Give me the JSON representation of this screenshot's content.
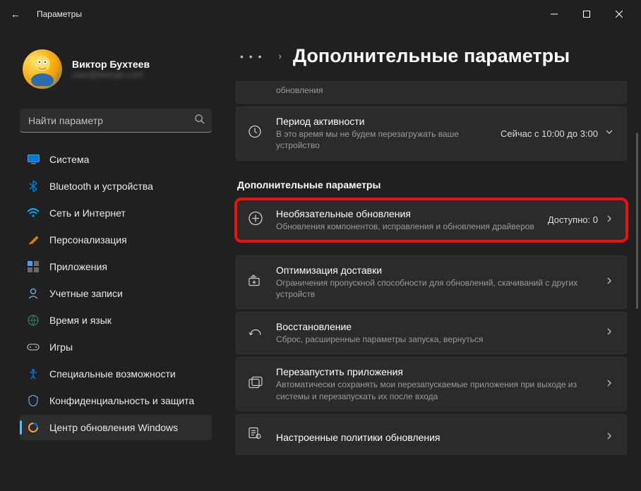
{
  "titlebar": {
    "back": "←",
    "title": "Параметры"
  },
  "profile": {
    "name": "Виктор Бухтеев",
    "email": "user@domain.com"
  },
  "search": {
    "placeholder": "Найти параметр"
  },
  "nav": [
    {
      "label": "Система"
    },
    {
      "label": "Bluetooth и устройства"
    },
    {
      "label": "Сеть и Интернет"
    },
    {
      "label": "Персонализация"
    },
    {
      "label": "Приложения"
    },
    {
      "label": "Учетные записи"
    },
    {
      "label": "Время и язык"
    },
    {
      "label": "Игры"
    },
    {
      "label": "Специальные возможности"
    },
    {
      "label": "Конфиденциальность и защита"
    },
    {
      "label": "Центр обновления Windows"
    }
  ],
  "breadcrumb": {
    "ellipsis": "• • •",
    "chev": "›",
    "title": "Дополнительные параметры"
  },
  "cards": {
    "update": {
      "sub": "обновления"
    },
    "activity": {
      "title": "Период активности",
      "sub": "В это время мы не будем перезагружать ваше устройство",
      "right": "Сейчас с 10:00 до 3:00"
    },
    "section": "Дополнительные параметры",
    "optional": {
      "title": "Необязательные обновления",
      "sub": "Обновления компонентов, исправления и обновления драйверов",
      "right": "Доступно: 0"
    },
    "delivery": {
      "title": "Оптимизация доставки",
      "sub": "Ограничения пропускной способности для обновлений, скачиваний с других устройств"
    },
    "recovery": {
      "title": "Восстановление",
      "sub": "Сброс, расширенные параметры запуска, вернуться"
    },
    "restart": {
      "title": "Перезапустить приложения",
      "sub": "Автоматически сохранять мои перезапускаемые приложения при выходе из системы и перезапускать их после входа"
    },
    "policies": {
      "title": "Настроенные политики обновления"
    }
  }
}
